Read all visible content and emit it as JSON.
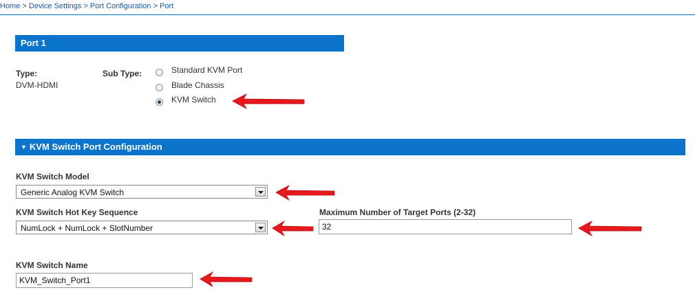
{
  "breadcrumb": {
    "items": [
      "Home",
      "Device Settings",
      "Port Configuration",
      "Port"
    ],
    "separator": ">"
  },
  "port_section": {
    "title": "Port 1",
    "type_label": "Type:",
    "type_value": "DVM-HDMI",
    "subtype_label": "Sub Type:",
    "subtype_options": [
      {
        "label": "Standard KVM Port",
        "checked": false
      },
      {
        "label": "Blade Chassis",
        "checked": false
      },
      {
        "label": "KVM Switch",
        "checked": true
      }
    ]
  },
  "kvm_section": {
    "title": "KVM Switch Port Configuration",
    "model_label": "KVM Switch Model",
    "model_value": "Generic Analog KVM Switch",
    "hotkey_label": "KVM Switch Hot Key Sequence",
    "hotkey_value": "NumLock + NumLock + SlotNumber",
    "max_ports_label": "Maximum Number of Target Ports (2-32)",
    "max_ports_value": "32",
    "name_label": "KVM Switch Name",
    "name_value": "KVM_Switch_Port1"
  },
  "colors": {
    "header_bar": "#0a74cc",
    "link": "#1a56a5",
    "annotation_arrow": "#e8191c"
  },
  "icons": {
    "collapse": "triangle-down-icon",
    "annotation": "red-arrow-icon"
  }
}
